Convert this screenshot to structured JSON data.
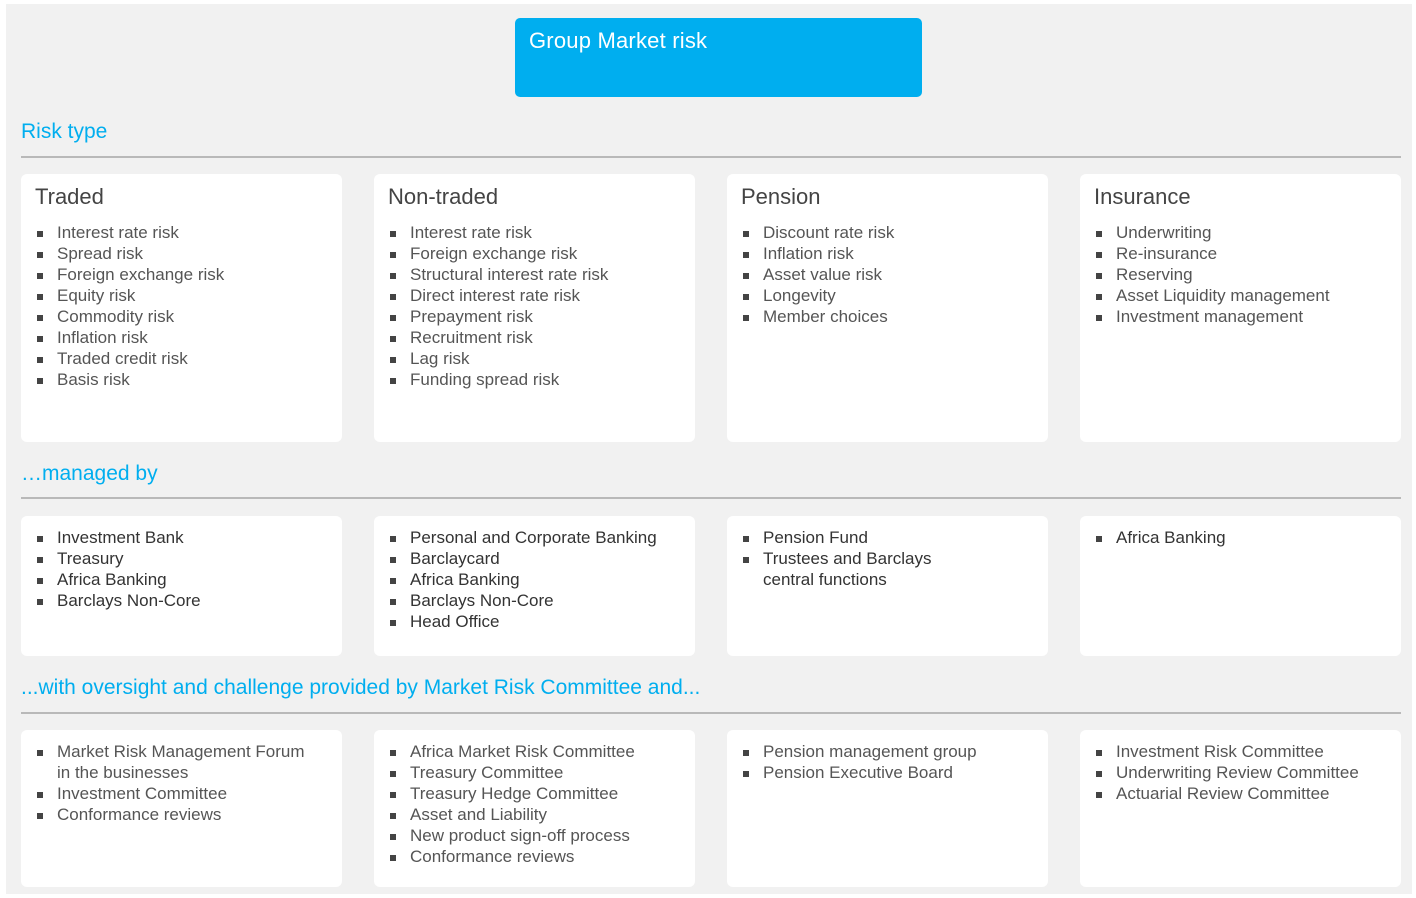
{
  "title": "Group Market risk",
  "colors": {
    "accent": "#00aeef",
    "card_bg": "#ffffff",
    "canvas_bg": "#f1f1f1"
  },
  "sections": [
    {
      "heading": "Risk type"
    },
    {
      "heading": "…managed by"
    },
    {
      "heading": "...with oversight and challenge provided by Market Risk Committee and..."
    }
  ],
  "risk_types": [
    {
      "title": "Traded",
      "items": [
        "Interest rate risk",
        "Spread risk",
        "Foreign exchange risk",
        "Equity risk",
        "Commodity risk",
        "Inflation risk",
        "Traded credit risk",
        "Basis risk"
      ]
    },
    {
      "title": "Non-traded",
      "items": [
        "Interest rate risk",
        "Foreign exchange risk",
        "Structural interest rate risk",
        "Direct interest rate risk",
        "Prepayment risk",
        "Recruitment risk",
        "Lag risk",
        "Funding spread risk"
      ]
    },
    {
      "title": "Pension",
      "items": [
        "Discount rate risk",
        "Inflation risk",
        "Asset value risk",
        "Longevity",
        "Member choices"
      ]
    },
    {
      "title": "Insurance",
      "items": [
        "Underwriting",
        "Re-insurance",
        "Reserving",
        "Asset Liquidity management",
        "Investment management"
      ]
    }
  ],
  "managed_by": [
    {
      "items": [
        "Investment Bank",
        "Treasury",
        "Africa Banking",
        "Barclays Non-Core"
      ]
    },
    {
      "items": [
        "Personal and Corporate Banking",
        "Barclaycard",
        "Africa Banking",
        "Barclays Non-Core",
        "Head Office"
      ]
    },
    {
      "items": [
        "Pension Fund",
        "Trustees and Barclays\ncentral functions"
      ]
    },
    {
      "items": [
        "Africa Banking"
      ]
    }
  ],
  "oversight": [
    {
      "items": [
        "Market Risk Management Forum\nin the businesses",
        "Investment Committee",
        "Conformance reviews"
      ]
    },
    {
      "items": [
        "Africa Market Risk Committee",
        "Treasury Committee",
        "Treasury Hedge Committee",
        "Asset and Liability",
        "New product sign-off process",
        "Conformance reviews"
      ]
    },
    {
      "items": [
        "Pension management group",
        "Pension Executive Board"
      ]
    },
    {
      "items": [
        "Investment Risk Committee",
        "Underwriting Review Committee",
        "Actuarial Review Committee"
      ]
    }
  ]
}
